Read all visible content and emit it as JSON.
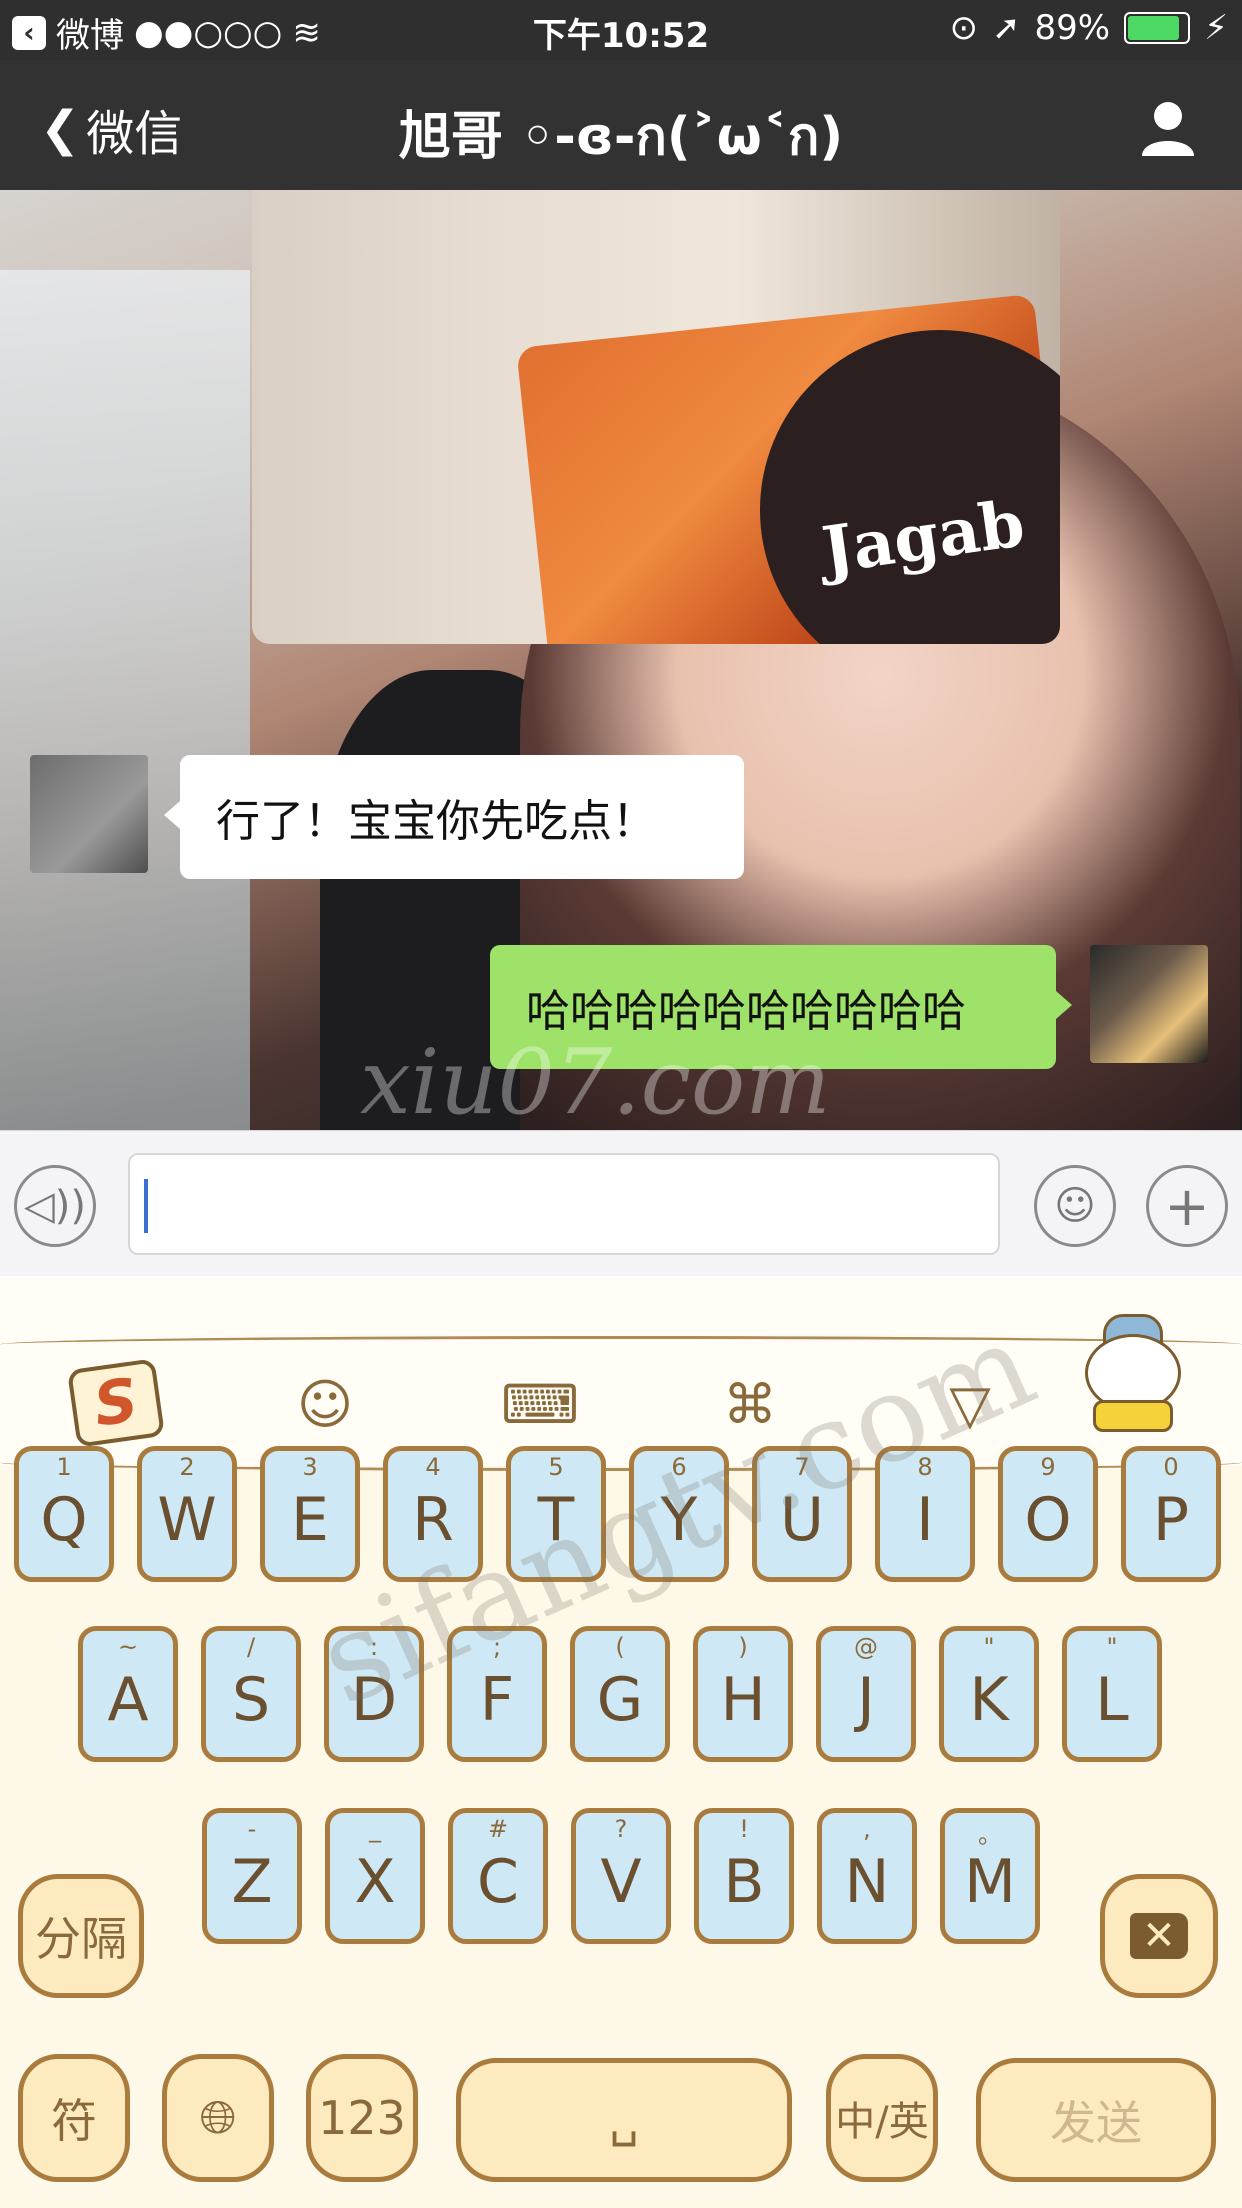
{
  "status_bar": {
    "carrier": "微博",
    "signal": "●●○○○",
    "time": "下午10:52",
    "battery_percent": "89%",
    "battery_level": 0.89,
    "battery_color": "#4cd964"
  },
  "nav": {
    "back_label": "微信",
    "title": "旭哥 ◦-ɞ-ก(˃ω˂ก)",
    "user_icon": "person-icon"
  },
  "chat": {
    "watermark": "xiu07.com",
    "photo_text": "Jagab",
    "messages": [
      {
        "from": "other",
        "text": "行了！宝宝你先吃点！"
      },
      {
        "from": "me",
        "text": "哈哈哈哈哈哈哈哈哈哈",
        "bubble_color": "#9ee26a"
      }
    ]
  },
  "input_bar": {
    "voice_icon": "voice-icon",
    "emoji_icon": "emoji-icon",
    "plus_icon": "plus-icon",
    "text_value": ""
  },
  "keyboard": {
    "toolbar": {
      "logo": "S",
      "icons": [
        "sogou-logo-icon",
        "smile-icon",
        "keyboard-icon",
        "command-icon",
        "hide-keyboard-icon",
        "mascot-icon"
      ]
    },
    "row1": [
      {
        "key": "Q",
        "sub": "1"
      },
      {
        "key": "W",
        "sub": "2"
      },
      {
        "key": "E",
        "sub": "3"
      },
      {
        "key": "R",
        "sub": "4"
      },
      {
        "key": "T",
        "sub": "5"
      },
      {
        "key": "Y",
        "sub": "6"
      },
      {
        "key": "U",
        "sub": "7"
      },
      {
        "key": "I",
        "sub": "8"
      },
      {
        "key": "O",
        "sub": "9"
      },
      {
        "key": "P",
        "sub": "0"
      }
    ],
    "row2": [
      {
        "key": "A",
        "sub": "~"
      },
      {
        "key": "S",
        "sub": "/"
      },
      {
        "key": "D",
        "sub": ":"
      },
      {
        "key": "F",
        "sub": ";"
      },
      {
        "key": "G",
        "sub": "("
      },
      {
        "key": "H",
        "sub": ")"
      },
      {
        "key": "J",
        "sub": "@"
      },
      {
        "key": "K",
        "sub": "\""
      },
      {
        "key": "L",
        "sub": "\""
      }
    ],
    "row3": [
      {
        "key": "Z",
        "sub": "-"
      },
      {
        "key": "X",
        "sub": "_"
      },
      {
        "key": "C",
        "sub": "#"
      },
      {
        "key": "V",
        "sub": "?"
      },
      {
        "key": "B",
        "sub": "!"
      },
      {
        "key": "N",
        "sub": ","
      },
      {
        "key": "M",
        "sub": "。"
      }
    ],
    "separator_label": "分隔",
    "symbol_label": "符",
    "numbers_label": "123",
    "space_label": "␣",
    "lang_label": "中/英",
    "send_label": "发送",
    "watermark": "sifangtv.com",
    "key_color": "#cfe8f5",
    "border_color": "#a97b3c"
  }
}
